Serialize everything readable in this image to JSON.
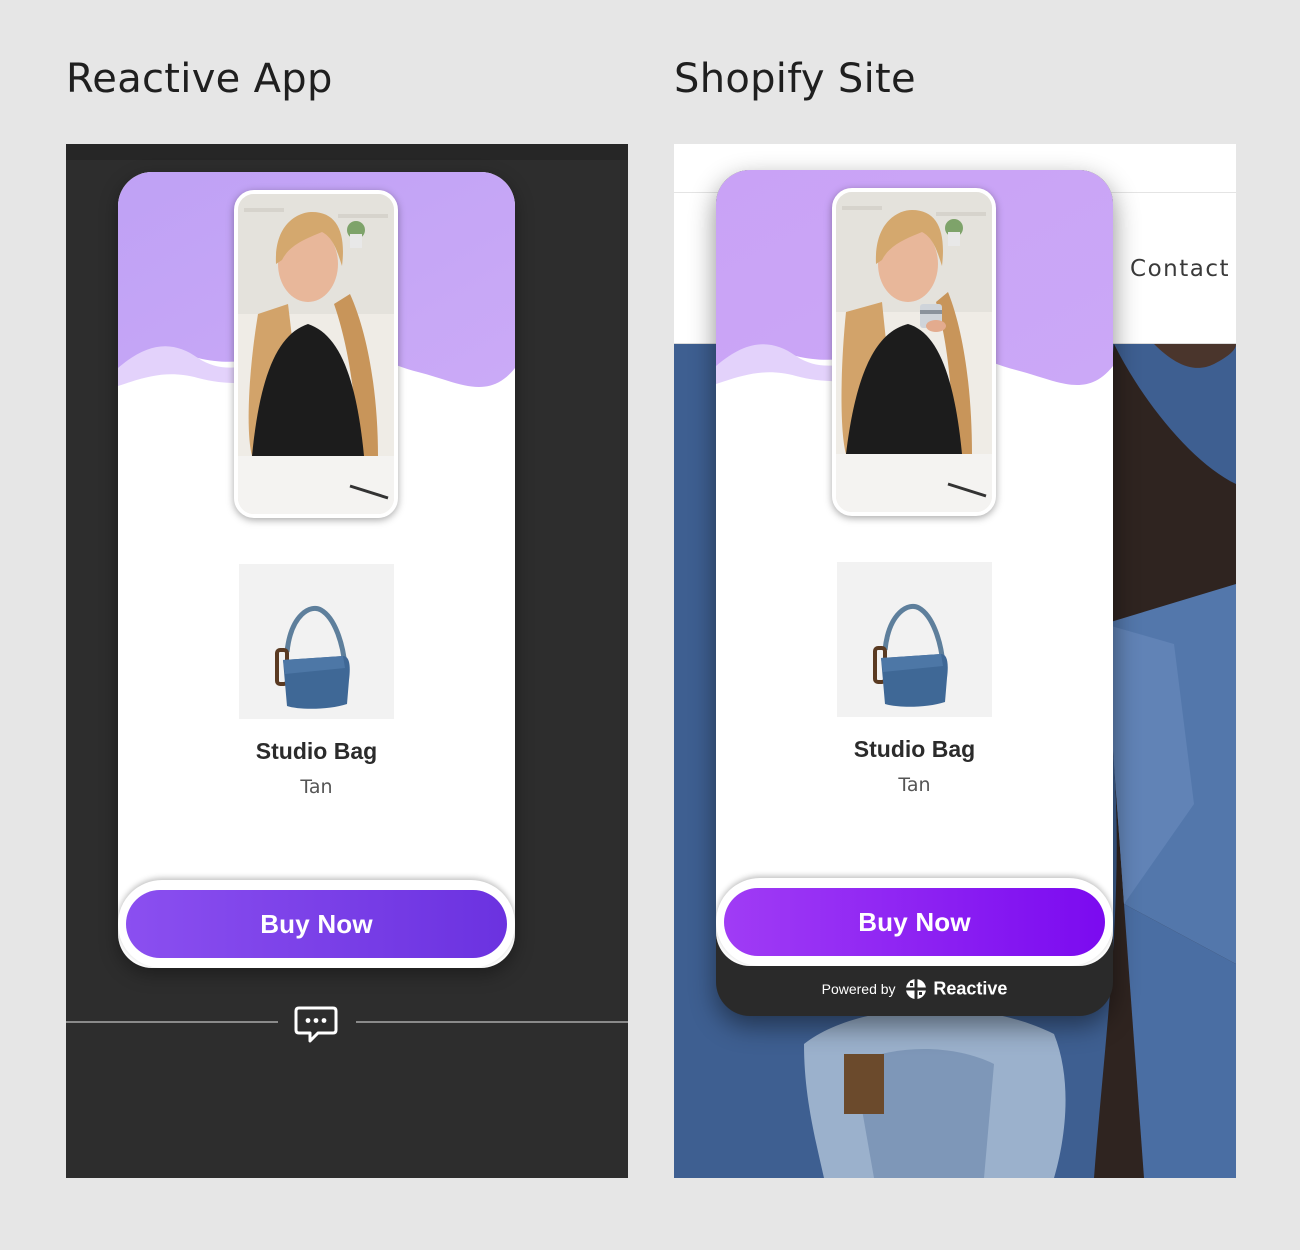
{
  "headings": {
    "left": "Reactive App",
    "right": "Shopify Site"
  },
  "shopify": {
    "nav_contact": "Contact"
  },
  "widget": {
    "product_name": "Studio Bag",
    "product_variant": "Tan",
    "buy_label": "Buy Now",
    "powered_by": "Powered by",
    "brand": "Reactive"
  },
  "colors": {
    "accent_purple": "#c8a3f5",
    "button_left": "#7a3fe8",
    "button_right": "#8d18f3",
    "app_bg": "#2d2d2d"
  },
  "icons": {
    "chat": "chat-bubble-dots-icon",
    "brand_logo": "reactive-logo-icon"
  }
}
